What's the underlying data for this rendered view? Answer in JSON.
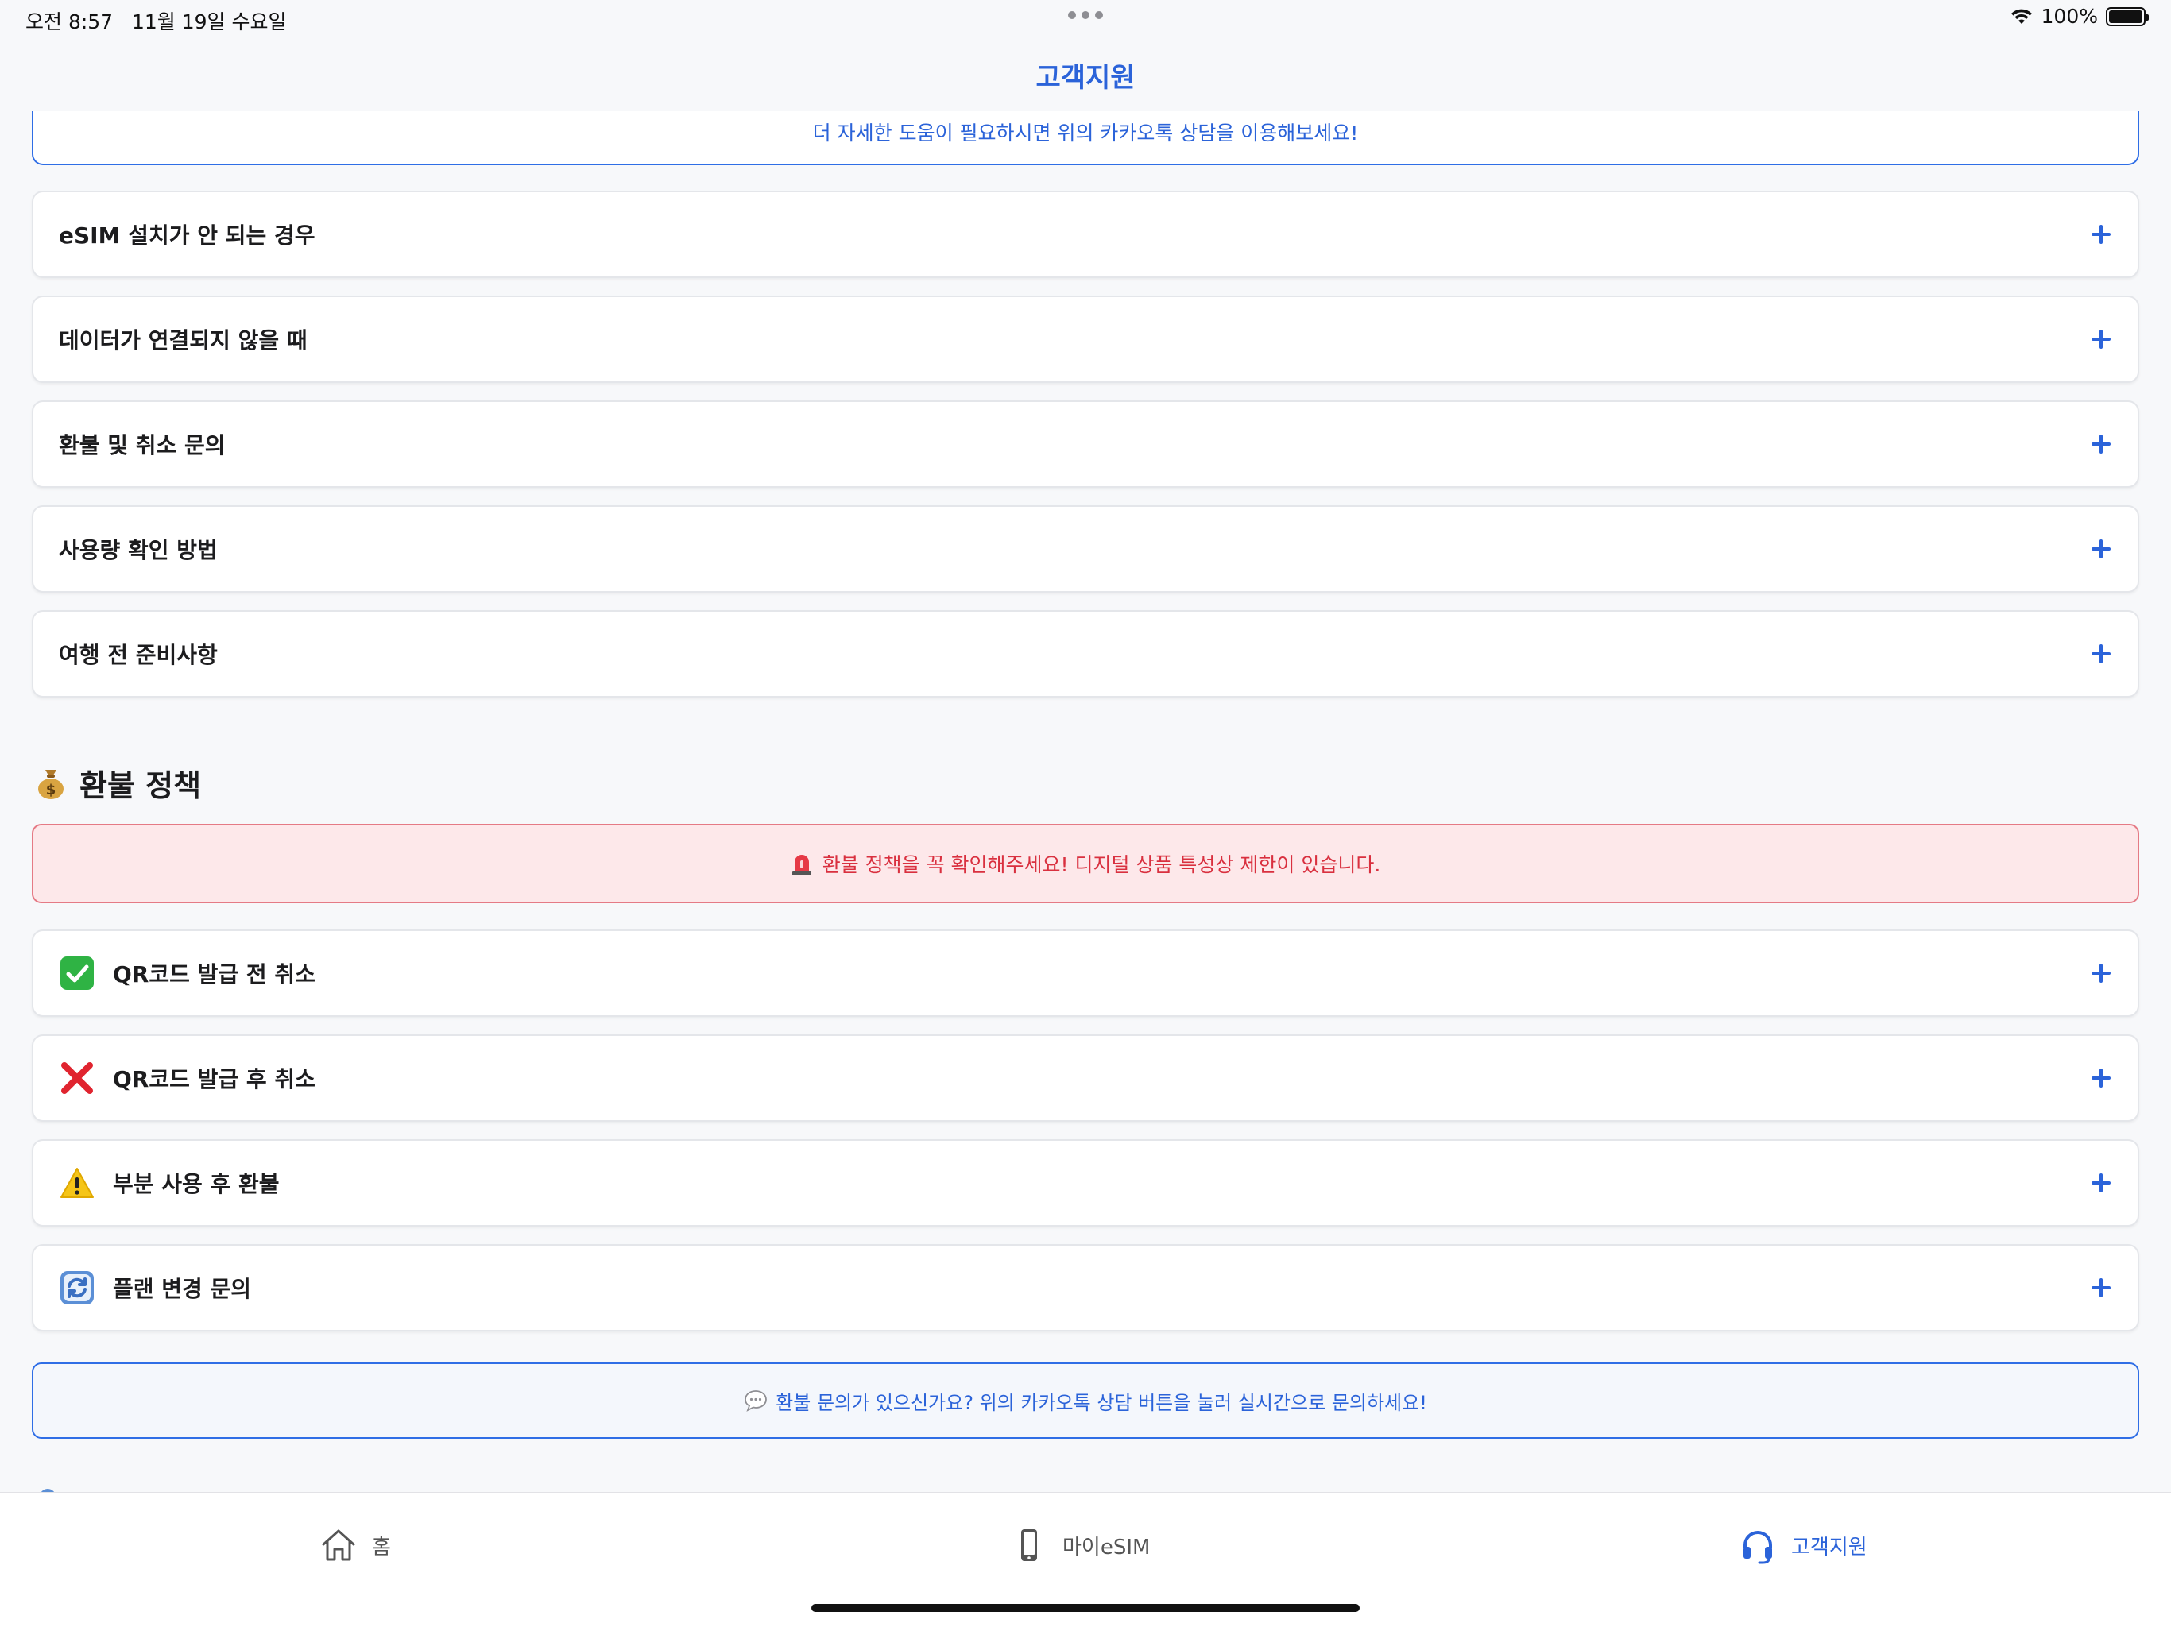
{
  "status_bar": {
    "time": "오전 8:57",
    "date": "11월 19일 수요일",
    "battery": "100%"
  },
  "nav": {
    "title": "고객지원"
  },
  "help_note": "더 자세한 도움이 필요하시면 위의 카카오톡 상담을 이용해보세요!",
  "faq_items": [
    {
      "label": "eSIM 설치가 안 되는 경우"
    },
    {
      "label": "데이터가 연결되지 않을 때"
    },
    {
      "label": "환불 및 취소 문의"
    },
    {
      "label": "사용량 확인 방법"
    },
    {
      "label": "여행 전 준비사항"
    }
  ],
  "refund_section": {
    "title": "환불 정책",
    "title_icon": "money-bag-icon",
    "warning": "환불 정책을 꼭 확인해주세요! 디지털 상품 특성상 제한이 있습니다.",
    "warning_icon": "siren-icon",
    "items": [
      {
        "label": "QR코드 발급 전 취소",
        "icon": "check-mark-icon"
      },
      {
        "label": "QR코드 발급 후 취소",
        "icon": "cross-mark-icon"
      },
      {
        "label": "부분 사용 후 환불",
        "icon": "warning-icon"
      },
      {
        "label": "플랜 변경 문의",
        "icon": "refresh-icon"
      }
    ],
    "info": "환불 문의가 있으신가요? 위의 카카오톡 상담 버튼을 눌러 실시간으로 문의하세요!",
    "info_icon": "speech-bubble-icon"
  },
  "tab_bar": {
    "tabs": [
      {
        "label": "홈",
        "icon": "home-icon",
        "active": false
      },
      {
        "label": "마이eSIM",
        "icon": "phone-icon",
        "active": false
      },
      {
        "label": "고객지원",
        "icon": "headset-icon",
        "active": true
      }
    ]
  },
  "colors": {
    "accent": "#2b63d9",
    "warning_bg": "#fde8ea",
    "warning_text": "#d9303f"
  }
}
